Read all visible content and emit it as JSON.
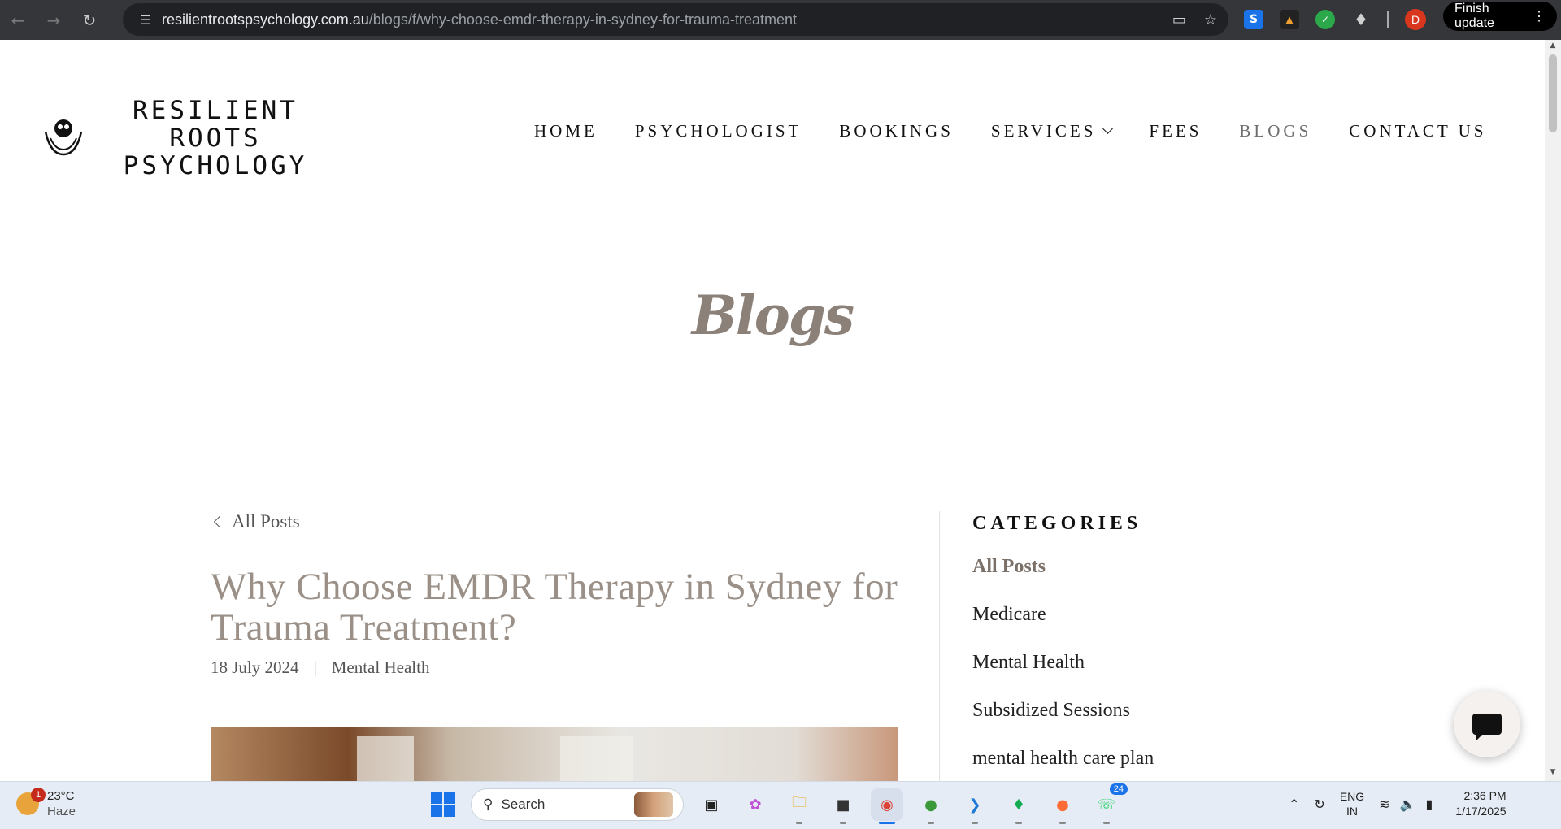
{
  "browser": {
    "url_domain": "resilientrootspsychology.com.au",
    "url_path": "/blogs/f/why-choose-emdr-therapy-in-sydney-for-trauma-treatment",
    "finish_update_label": "Finish update",
    "profile_initial": "D"
  },
  "site": {
    "logo_line1": "RESILIENT ROOTS",
    "logo_line2": "PSYCHOLOGY",
    "nav": {
      "home": "HOME",
      "psychologist": "PSYCHOLOGIST",
      "bookings": "BOOKINGS",
      "services": "SERVICES",
      "fees": "FEES",
      "blogs": "BLOGS",
      "contact": "CONTACT US"
    },
    "page_heading": "Blogs"
  },
  "post": {
    "back_label": "All Posts",
    "title": "Why Choose EMDR Therapy in Sydney for Trauma Treatment?",
    "date": "18 July 2024",
    "separator": "|",
    "category": "Mental Health"
  },
  "sidebar": {
    "heading": "CATEGORIES",
    "categories": [
      {
        "label": "All Posts",
        "active": true
      },
      {
        "label": "Medicare",
        "active": false
      },
      {
        "label": "Mental Health",
        "active": false
      },
      {
        "label": "Subsidized Sessions",
        "active": false
      },
      {
        "label": "mental health care plan",
        "active": false
      }
    ]
  },
  "taskbar": {
    "weather_temp": "23°C",
    "weather_desc": "Haze",
    "weather_badge": "1",
    "search_placeholder": "Search",
    "whatsapp_badge": "24",
    "lang_line1": "ENG",
    "lang_line2": "IN",
    "time": "2:36 PM",
    "date": "1/17/2025"
  },
  "colors": {
    "accent_title": "#9a9087",
    "heading_script": "#8c8179",
    "chrome_bg": "#35363a"
  }
}
